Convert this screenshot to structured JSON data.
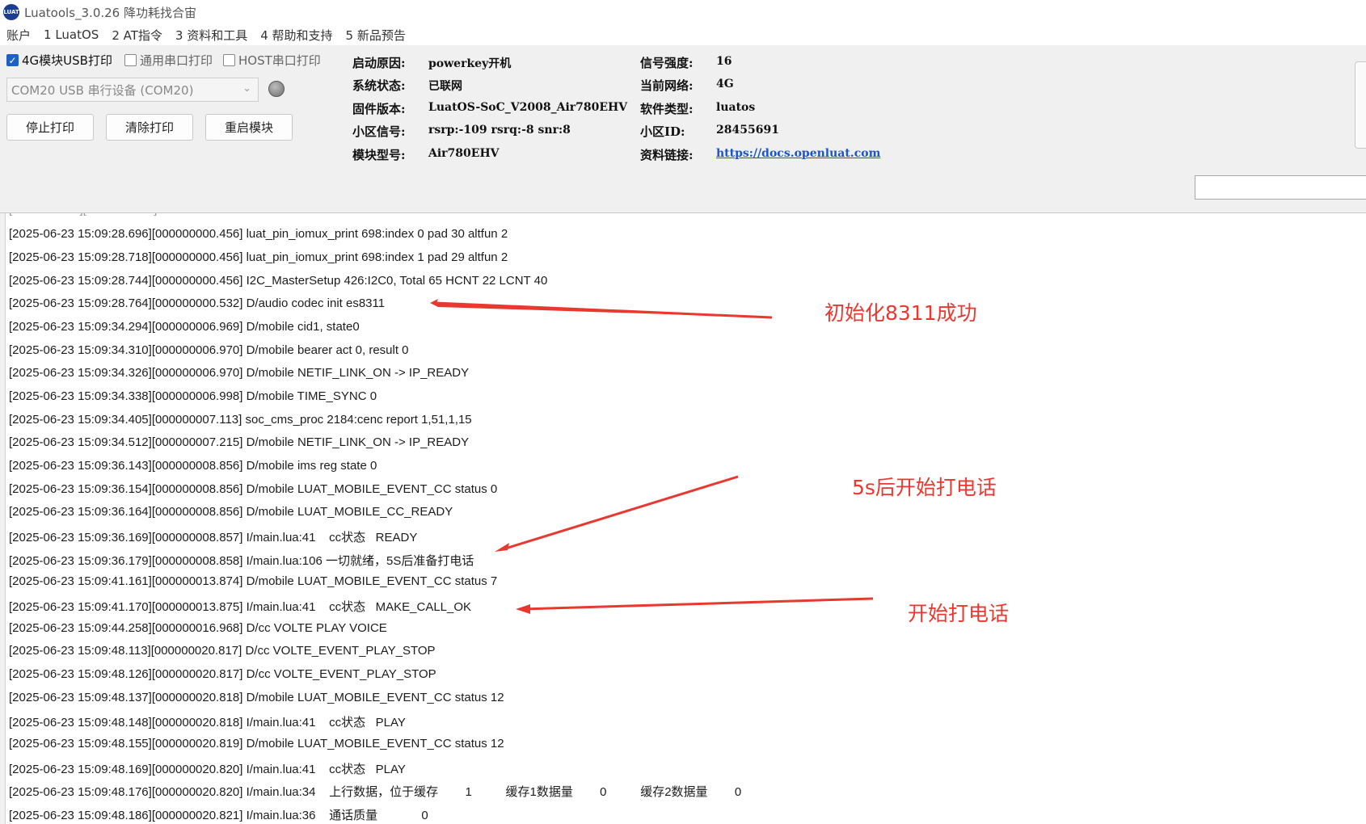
{
  "window": {
    "title": "Luatools_3.0.26 降功耗找合宙",
    "icon_label": "LUAT"
  },
  "menu": [
    "账户",
    "1 LuatOS",
    "2 AT指令",
    "3 资料和工具",
    "4 帮助和支持",
    "5 新品预告"
  ],
  "toolbar": {
    "checkboxes": [
      {
        "label": "4G模块USB打印",
        "checked": true
      },
      {
        "label": "通用串口打印",
        "checked": false
      },
      {
        "label": "HOST串口打印",
        "checked": false
      }
    ],
    "port_select_value": "COM20 USB 串行设备 (COM20)",
    "buttons": {
      "stop": "停止打印",
      "clear": "清除打印",
      "restart": "重启模块"
    }
  },
  "info": {
    "boot_reason_label": "启动原因:",
    "boot_reason": "powerkey开机",
    "system_status_label": "系统状态:",
    "system_status": "已联网",
    "firmware_label": "固件版本:",
    "firmware": "LuatOS-SoC_V2008_Air780EHV",
    "cell_signal_label": "小区信号:",
    "cell_signal": "rsrp:-109 rsrq:-8 snr:8",
    "module_model_label": "模块型号:",
    "module_model": "Air780EHV",
    "signal_strength_label": "信号强度:",
    "signal_strength": "16",
    "network_label": "当前网络:",
    "network": "4G",
    "software_type_label": "软件类型:",
    "software_type": "luatos",
    "cell_id_label": "小区ID:",
    "cell_id": "28455691",
    "docs_link_label": "资料链接:",
    "docs_link": "https://docs.openluat.com"
  },
  "log_lines": [
    "[2025-06-23 15:09:28.696][000000000.456] luat_pin_iomux_print 698:index 0 pad 30 altfun 2",
    "[2025-06-23 15:09:28.718][000000000.456] luat_pin_iomux_print 698:index 1 pad 29 altfun 2",
    "[2025-06-23 15:09:28.744][000000000.456] I2C_MasterSetup 426:I2C0, Total 65 HCNT 22 LCNT 40",
    "[2025-06-23 15:09:28.764][000000000.532] D/audio codec init es8311",
    "[2025-06-23 15:09:34.294][000000006.969] D/mobile cid1, state0",
    "[2025-06-23 15:09:34.310][000000006.970] D/mobile bearer act 0, result 0",
    "[2025-06-23 15:09:34.326][000000006.970] D/mobile NETIF_LINK_ON -> IP_READY",
    "[2025-06-23 15:09:34.338][000000006.998] D/mobile TIME_SYNC 0",
    "[2025-06-23 15:09:34.405][000000007.113] soc_cms_proc 2184:cenc report 1,51,1,15",
    "[2025-06-23 15:09:34.512][000000007.215] D/mobile NETIF_LINK_ON -> IP_READY",
    "[2025-06-23 15:09:36.143][000000008.856] D/mobile ims reg state 0",
    "[2025-06-23 15:09:36.154][000000008.856] D/mobile LUAT_MOBILE_EVENT_CC status 0",
    "[2025-06-23 15:09:36.164][000000008.856] D/mobile LUAT_MOBILE_CC_READY",
    "[2025-06-23 15:09:36.169][000000008.857] I/main.lua:41    cc状态   READY",
    "[2025-06-23 15:09:36.179][000000008.858] I/main.lua:106 一切就绪，5S后准备打电话",
    "[2025-06-23 15:09:41.161][000000013.874] D/mobile LUAT_MOBILE_EVENT_CC status 7",
    "[2025-06-23 15:09:41.170][000000013.875] I/main.lua:41    cc状态   MAKE_CALL_OK",
    "[2025-06-23 15:09:44.258][000000016.968] D/cc VOLTE PLAY VOICE",
    "[2025-06-23 15:09:48.113][000000020.817] D/cc VOLTE_EVENT_PLAY_STOP",
    "[2025-06-23 15:09:48.126][000000020.817] D/cc VOLTE_EVENT_PLAY_STOP",
    "[2025-06-23 15:09:48.137][000000020.818] D/mobile LUAT_MOBILE_EVENT_CC status 12",
    "[2025-06-23 15:09:48.148][000000020.818] I/main.lua:41    cc状态   PLAY",
    "[2025-06-23 15:09:48.155][000000020.819] D/mobile LUAT_MOBILE_EVENT_CC status 12",
    "[2025-06-23 15:09:48.169][000000020.820] I/main.lua:41    cc状态   PLAY",
    "[2025-06-23 15:09:48.176][000000020.820] I/main.lua:34    上行数据，位于缓存        1          缓存1数据量        0          缓存2数据量        0",
    "[2025-06-23 15:09:48.186][000000020.821] I/main.lua:36    通话质量             0"
  ],
  "annotations": {
    "codec_init": "初始化8311成功",
    "call_in_5s": "5s后开始打电话",
    "start_call": "开始打电话",
    "color": "#e8382f"
  }
}
